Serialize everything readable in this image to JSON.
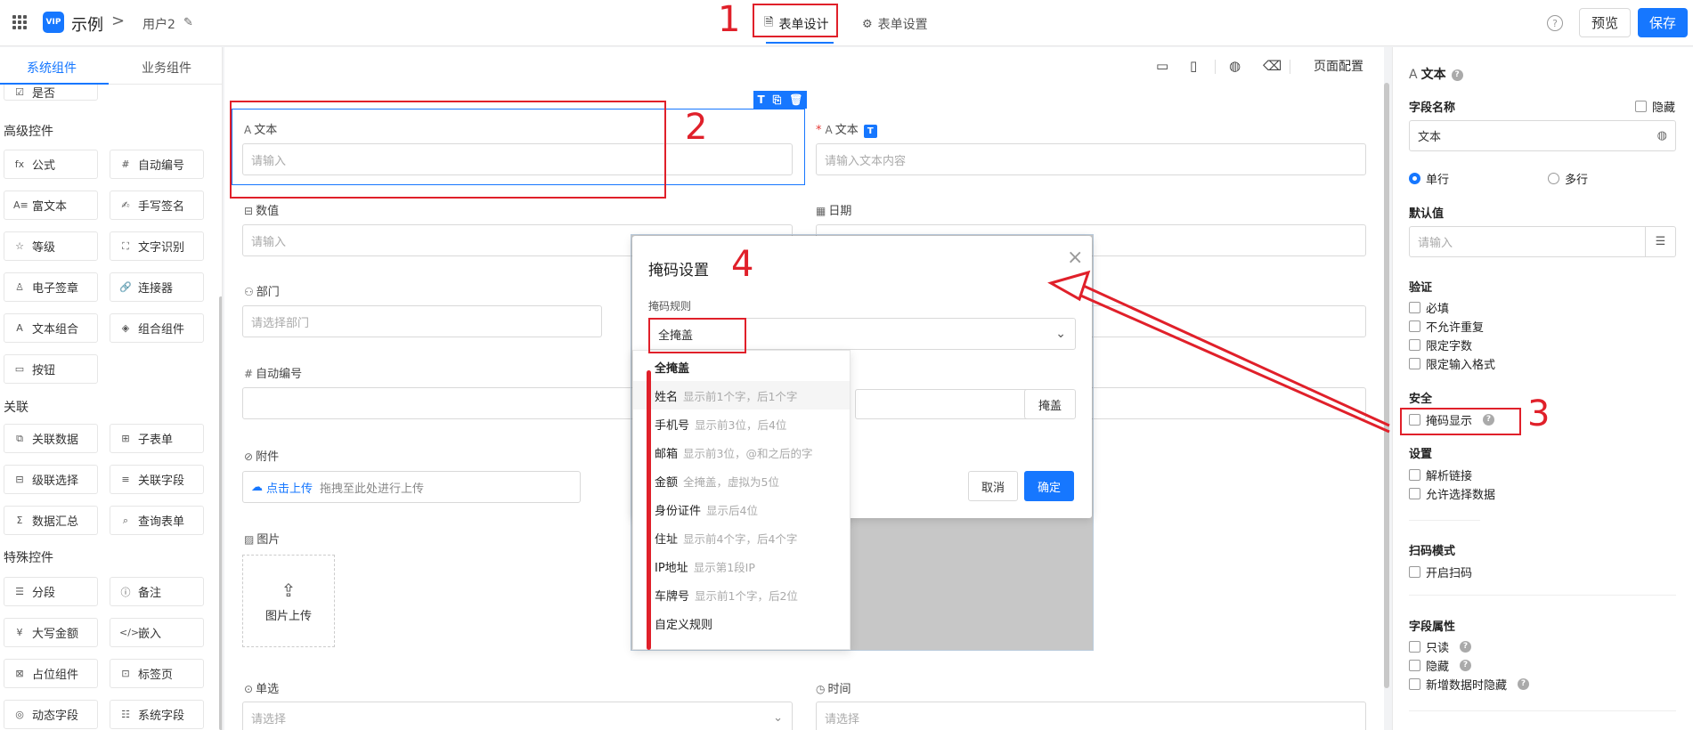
{
  "topbar": {
    "app_logo": "VIP",
    "app_name": "示例",
    "crumb_sep": ">",
    "form_name": "用户2",
    "tabs": [
      {
        "label": "表单设计",
        "icon": "document-icon"
      },
      {
        "label": "表单设置",
        "icon": "gear-icon"
      }
    ],
    "help": "?",
    "preview_label": "预览",
    "save_label": "保存"
  },
  "left": {
    "tabs": [
      "系统组件",
      "业务组件"
    ],
    "partial_item": "是否",
    "sections": [
      {
        "title": "高级控件"
      },
      {
        "title": "关联"
      },
      {
        "title": "特殊控件"
      }
    ],
    "items": [
      {
        "icon": "fx",
        "label": "公式"
      },
      {
        "icon": "#",
        "label": "自动编号"
      },
      {
        "icon": "A≡",
        "label": "富文本"
      },
      {
        "icon": "✍",
        "label": "手写签名"
      },
      {
        "icon": "☆",
        "label": "等级"
      },
      {
        "icon": "⛶",
        "label": "文字识别"
      },
      {
        "icon": "♙",
        "label": "电子签章"
      },
      {
        "icon": "🔗",
        "label": "连接器"
      },
      {
        "icon": "A",
        "label": "文本组合"
      },
      {
        "icon": "◈",
        "label": "组合组件"
      },
      {
        "icon": "▭",
        "label": "按钮"
      },
      {
        "icon": "⧉",
        "label": "关联数据"
      },
      {
        "icon": "⊞",
        "label": "子表单"
      },
      {
        "icon": "⊟",
        "label": "级联选择"
      },
      {
        "icon": "≡",
        "label": "关联字段"
      },
      {
        "icon": "Σ",
        "label": "数据汇总"
      },
      {
        "icon": "⌕",
        "label": "查询表单"
      },
      {
        "icon": "☰",
        "label": "分段"
      },
      {
        "icon": "ⓘ",
        "label": "备注"
      },
      {
        "icon": "¥",
        "label": "大写金额"
      },
      {
        "icon": "</>",
        "label": "嵌入"
      },
      {
        "icon": "⊠",
        "label": "占位组件"
      },
      {
        "icon": "⊡",
        "label": "标签页"
      },
      {
        "icon": "◎",
        "label": "动态字段"
      },
      {
        "icon": "☷",
        "label": "系统字段"
      }
    ]
  },
  "canvas": {
    "page_config": "页面配置",
    "field_tools": [
      "T",
      "⎘",
      "🗑"
    ],
    "fields": {
      "text1": {
        "label": "文本",
        "placeholder": "请输入"
      },
      "text2": {
        "label": "文本",
        "placeholder": "请输入文本内容",
        "badge": "T"
      },
      "number": {
        "label": "数值",
        "placeholder": "请输入"
      },
      "date": {
        "label": "日期"
      },
      "dept": {
        "label": "部门",
        "placeholder": "请选择部门"
      },
      "autonum": {
        "label": "自动编号"
      },
      "attach": {
        "label": "附件",
        "upload_link": "点击上传",
        "upload_hint": "拖拽至此处进行上传"
      },
      "image": {
        "label": "图片",
        "upload": "图片上传"
      },
      "radio": {
        "label": "单选",
        "placeholder": "请选择"
      },
      "time": {
        "label": "时间",
        "placeholder": "请选择"
      }
    }
  },
  "modal": {
    "title": "掩码设置",
    "rule_label": "掩码规则",
    "selected": "全掩盖",
    "mask_btn": "掩盖",
    "cancel": "取消",
    "ok": "确定",
    "options": [
      {
        "name": "全掩盖",
        "desc": ""
      },
      {
        "name": "姓名",
        "desc": "显示前1个字，后1个字"
      },
      {
        "name": "手机号",
        "desc": "显示前3位，后4位"
      },
      {
        "name": "邮箱",
        "desc": "显示前3位，@和之后的字"
      },
      {
        "name": "金额",
        "desc": "全掩盖，虚拟为5位"
      },
      {
        "name": "身份证件",
        "desc": "显示后4位"
      },
      {
        "name": "住址",
        "desc": "显示前4个字，后4个字"
      },
      {
        "name": "IP地址",
        "desc": "显示第1段IP"
      },
      {
        "name": "车牌号",
        "desc": "显示前1个字，后2位"
      },
      {
        "name": "自定义规则",
        "desc": ""
      }
    ]
  },
  "right": {
    "title": "文本",
    "field_name_label": "字段名称",
    "hide_label": "隐藏",
    "field_name_value": "文本",
    "single_line": "单行",
    "multi_line": "多行",
    "default_label": "默认值",
    "default_placeholder": "请输入",
    "validate_label": "验证",
    "validate": [
      "必填",
      "不允许重复",
      "限定字数",
      "限定输入格式"
    ],
    "security_label": "安全",
    "mask_display": "掩码显示",
    "settings_label": "设置",
    "settings": [
      "解析链接",
      "允许选择数据"
    ],
    "scan_label": "扫码模式",
    "scan_enable": "开启扫码",
    "attr_label": "字段属性",
    "attrs": [
      "只读",
      "隐藏",
      "新增数据时隐藏"
    ]
  },
  "annotations": [
    "1",
    "2",
    "3",
    "4"
  ],
  "colors": {
    "accent": "#1677ff",
    "annotation": "#e0202a"
  }
}
